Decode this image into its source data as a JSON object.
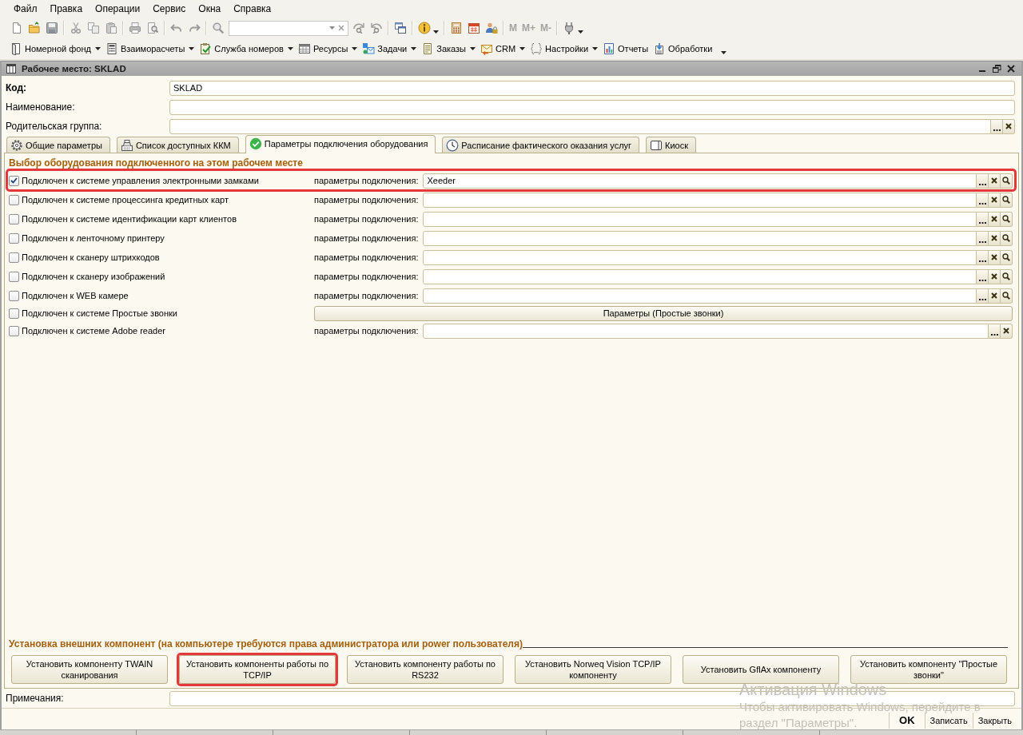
{
  "menu_bar": [
    {
      "label": "Файл"
    },
    {
      "label": "Правка"
    },
    {
      "label": "Операции"
    },
    {
      "label": "Сервис"
    },
    {
      "label": "Окна"
    },
    {
      "label": "Справка"
    }
  ],
  "toolbar": {
    "memory_buttons": [
      {
        "label": "M",
        "disabled": true
      },
      {
        "label": "M+",
        "disabled": true
      },
      {
        "label": "M-",
        "disabled": true
      }
    ]
  },
  "nav_toolbar": [
    {
      "label": "Номерной фонд",
      "dropdown": true
    },
    {
      "label": "Взаиморасчеты",
      "dropdown": true
    },
    {
      "label": "Служба номеров",
      "dropdown": true
    },
    {
      "label": "Ресурсы",
      "dropdown": true
    },
    {
      "label": "Задачи",
      "dropdown": true
    },
    {
      "label": "Заказы",
      "dropdown": true
    },
    {
      "label": "CRM",
      "dropdown": true
    },
    {
      "label": "Настройки",
      "dropdown": true
    },
    {
      "label": "Отчеты",
      "dropdown": false
    },
    {
      "label": "Обработки",
      "dropdown": false
    }
  ],
  "window": {
    "title": "Рабочее место: SKLAD"
  },
  "header_fields": [
    {
      "kind": "code",
      "label": "Код:",
      "value": "SKLAD"
    },
    {
      "kind": "text",
      "label": "Наименование:"
    },
    {
      "kind": "reference",
      "label": "Родительская группа:",
      "actions": [
        {
          "kind": "select"
        },
        {
          "kind": "clear"
        }
      ]
    }
  ],
  "tabs": [
    {
      "label": "Общие параметры",
      "selected": false
    },
    {
      "label": "Список доступных ККМ",
      "selected": false
    },
    {
      "label": "Параметры подключения оборудования",
      "selected": true
    },
    {
      "label": "Расписание фактического оказания услуг",
      "selected": false
    },
    {
      "label": "Киоск",
      "selected": false
    }
  ],
  "equipment": {
    "heading": "Выбор оборудования подключенного на этом рабочем месте",
    "rows": [
      {
        "kind": "field",
        "label": "Подключен к системе управления электронными замками",
        "checked": true,
        "highlighted": true,
        "param_label": "параметры подключения:",
        "value": "Xeeder",
        "actions": [
          {
            "kind": "select"
          },
          {
            "kind": "clear"
          },
          {
            "kind": "open"
          }
        ]
      },
      {
        "kind": "field",
        "label": "Подключен к системе процессинга кредитных карт",
        "checked": false,
        "highlighted": false,
        "param_label": "параметры подключения:",
        "actions": [
          {
            "kind": "select"
          },
          {
            "kind": "clear"
          },
          {
            "kind": "open"
          }
        ]
      },
      {
        "kind": "field",
        "label": "Подключен к системе идентификации карт клиентов",
        "checked": false,
        "highlighted": false,
        "param_label": "параметры подключения:",
        "actions": [
          {
            "kind": "select"
          },
          {
            "kind": "clear"
          },
          {
            "kind": "open"
          }
        ]
      },
      {
        "kind": "field",
        "label": "Подключен к ленточному принтеру",
        "checked": false,
        "highlighted": false,
        "param_label": "параметры подключения:",
        "actions": [
          {
            "kind": "select"
          },
          {
            "kind": "clear"
          },
          {
            "kind": "open"
          }
        ]
      },
      {
        "kind": "field",
        "label": "Подключен к сканеру штрихкодов",
        "checked": false,
        "highlighted": false,
        "param_label": "параметры подключения:",
        "actions": [
          {
            "kind": "select"
          },
          {
            "kind": "clear"
          },
          {
            "kind": "open"
          }
        ]
      },
      {
        "kind": "field",
        "label": "Подключен к сканеру изображений",
        "checked": false,
        "highlighted": false,
        "param_label": "параметры подключения:",
        "actions": [
          {
            "kind": "select"
          },
          {
            "kind": "clear"
          },
          {
            "kind": "open"
          }
        ]
      },
      {
        "kind": "field",
        "label": "Подключен к WEB камере",
        "checked": false,
        "highlighted": false,
        "param_label": "параметры подключения:",
        "actions": [
          {
            "kind": "select"
          },
          {
            "kind": "clear"
          },
          {
            "kind": "open"
          }
        ]
      },
      {
        "kind": "button",
        "label": "Подключен к системе Простые звонки",
        "checked": false,
        "highlighted": false,
        "button": "Параметры (Простые звонки)"
      },
      {
        "kind": "field",
        "label": "Подключен к системе Adobe reader",
        "checked": false,
        "highlighted": false,
        "param_label": "параметры подключения:",
        "actions": [
          {
            "kind": "select"
          },
          {
            "kind": "clear"
          }
        ]
      }
    ]
  },
  "components": {
    "heading": "Установка внешних компонент (на компьютере требуются права администратора или power пользователя)",
    "buttons": [
      {
        "label": "Установить компоненту TWAIN сканирования",
        "highlighted": false
      },
      {
        "label": "Установить компоненты работы по TCP/IP",
        "highlighted": true
      },
      {
        "label": "Установить компоненту работы по RS232",
        "highlighted": false
      },
      {
        "label": "Установить Norweq Vision TCP/IP компоненту",
        "highlighted": false
      },
      {
        "label": "Установить GflAx компоненту",
        "highlighted": false
      },
      {
        "label": "Установить компоненту \"Простые звонки\"",
        "highlighted": false
      }
    ]
  },
  "notes": {
    "label": "Примечания:"
  },
  "footer_buttons": [
    {
      "label": "OK",
      "default": true
    },
    {
      "label": "Записать",
      "default": false
    },
    {
      "label": "Закрыть",
      "default": false
    }
  ],
  "os_notice": {
    "title": "Активация Windows",
    "message_lines": [
      "Чтобы активировать Windows, перейдите в",
      "раздел \"Параметры\"."
    ]
  }
}
